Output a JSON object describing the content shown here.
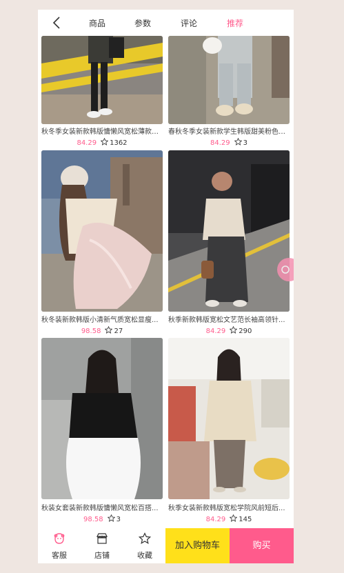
{
  "nav": {
    "tabs": [
      {
        "label": "商品"
      },
      {
        "label": "参数"
      },
      {
        "label": "评论"
      },
      {
        "label": "推荐"
      }
    ],
    "active_tab": "推荐",
    "accent_color": "#ff5b8c"
  },
  "products": [
    {
      "title": "秋冬季女装新款韩版慵懒风宽松薄款长...",
      "price": "84.29",
      "favorites": "1362"
    },
    {
      "title": "春秋冬季女装新款学生韩版甜美粉色针...",
      "price": "84.29",
      "favorites": "3"
    },
    {
      "title": "秋冬装新款韩版小清新气质宽松显瘦...",
      "price": "98.58",
      "favorites": "27"
    },
    {
      "title": "秋季新款韩版宽松文艺范长袖高领针...",
      "price": "84.29",
      "favorites": "290"
    },
    {
      "title": "秋装女套装新款韩版慵懒风宽松百搭...",
      "price": "98.58",
      "favorites": "3"
    },
    {
      "title": "秋季女装新款韩版宽松学院风前短后...",
      "price": "84.29",
      "favorites": "145"
    }
  ],
  "bottom_bar": {
    "service_label": "客服",
    "shop_label": "店铺",
    "favorite_label": "收藏",
    "add_to_cart_label": "加入购物车",
    "buy_label": "购买",
    "cart_color": "#ffe01a",
    "buy_color": "#ff5b8c"
  }
}
